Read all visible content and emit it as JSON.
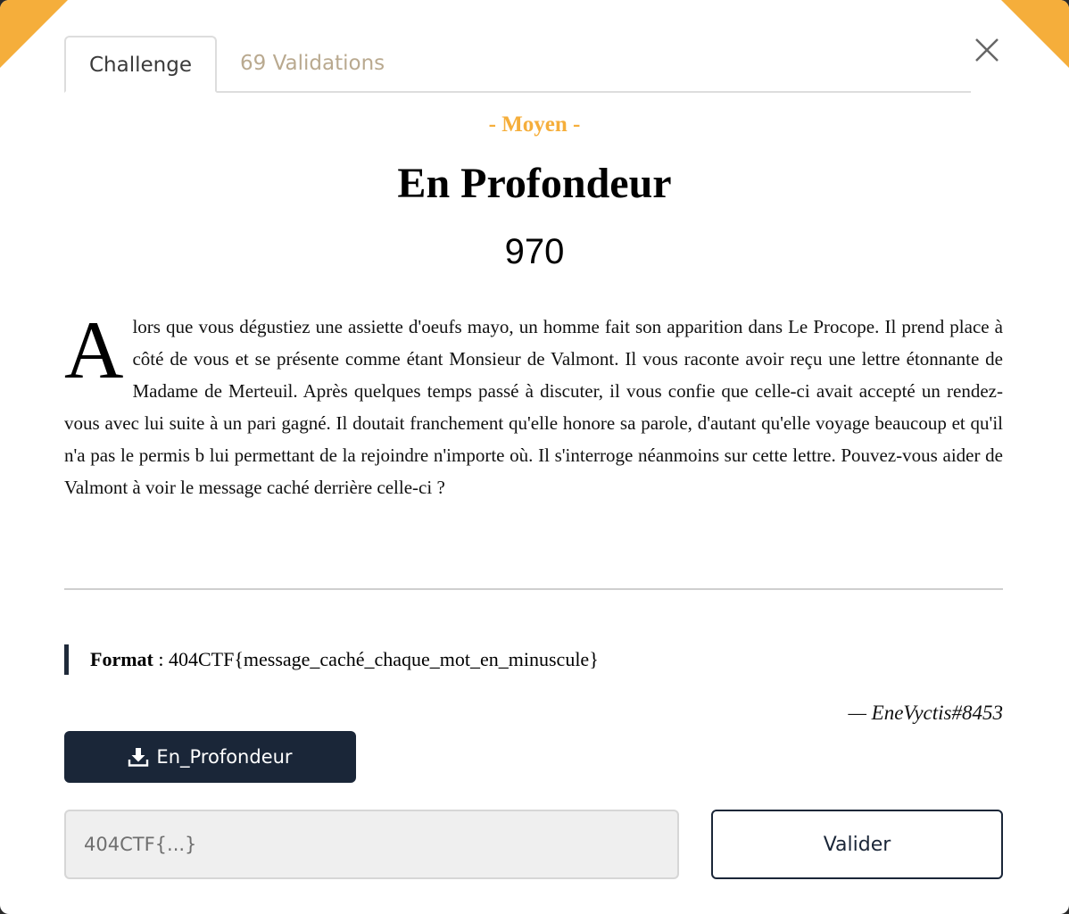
{
  "tabs": [
    {
      "label": "Challenge",
      "active": true
    },
    {
      "label": "69 Validations",
      "active": false
    }
  ],
  "challenge": {
    "difficulty": "- Moyen -",
    "title": "En Profondeur",
    "points": "970",
    "description_dropcap": "A",
    "description": "lors que vous dégustiez une assiette d'oeufs mayo, un homme fait son apparition dans Le Procope. Il prend place à côté de vous et se présente comme étant Monsieur de Valmont. Il vous raconte avoir reçu une lettre étonnante de Madame de Merteuil. Après quelques temps passé à discuter, il vous confie que celle-ci avait accepté un rendez-vous avec lui suite à un pari gagné. Il doutait franchement qu'elle honore sa parole, d'autant qu'elle voyage beaucoup et qu'il n'a pas le permis b lui permettant de la rejoindre n'importe où. Il s'interroge néanmoins sur cette lettre. Pouvez-vous aider de Valmont à voir le message caché derrière celle-ci ?",
    "format_label": "Format",
    "format_separator": " : ",
    "format_value": "404CTF{message_caché_chaque_mot_en_minuscule}",
    "author": "— EneVyctis#8453"
  },
  "download": {
    "label": "En_Profondeur",
    "icon": "download-icon"
  },
  "flag_input": {
    "placeholder": "404CTF{...}",
    "value": ""
  },
  "submit": {
    "label": "Valider"
  },
  "colors": {
    "accent": "#f5ae3b",
    "primary": "#1a2638",
    "tab_inactive": "#b9a98f"
  }
}
